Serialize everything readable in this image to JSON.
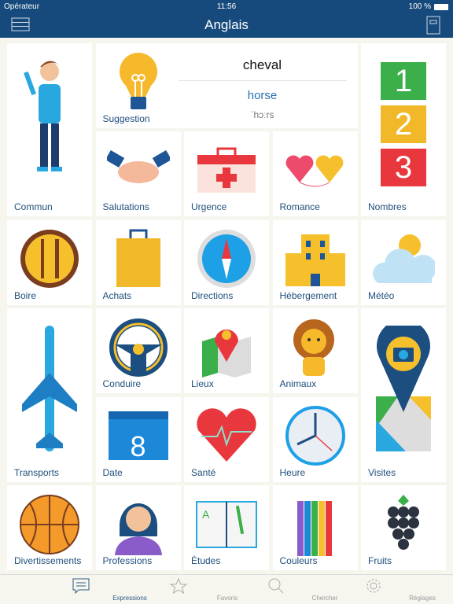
{
  "status": {
    "carrier": "Opérateur",
    "time": "11:56",
    "battery": "100 %"
  },
  "header": {
    "title": "Anglais"
  },
  "suggestion": {
    "label": "Suggestion",
    "word": "cheval",
    "translation": "horse",
    "phonetic": "ˈhɔːrs"
  },
  "tiles": {
    "commun": "Commun",
    "nombres": "Nombres",
    "salutations": "Salutations",
    "urgence": "Urgence",
    "romance": "Romance",
    "boire": "Boire",
    "achats": "Achats",
    "directions": "Directions",
    "hebergement": "Hébergement",
    "meteo": "Météo",
    "transports": "Transports",
    "conduire": "Conduire",
    "lieux": "Lieux",
    "animaux": "Animaux",
    "visites": "Visites",
    "date": "Date",
    "sante": "Santé",
    "heure": "Heure",
    "divertissements": "Divertissements",
    "professions": "Professions",
    "etudes": "Études",
    "couleurs": "Couleurs",
    "fruits": "Fruits"
  },
  "numbers": [
    "1",
    "2",
    "3"
  ],
  "calendar_day": "8",
  "tabbar": [
    {
      "label": "Expressions",
      "active": true
    },
    {
      "label": "Favoris"
    },
    {
      "label": "Chercher"
    },
    {
      "label": "Réglages"
    }
  ],
  "colors": {
    "header": "#174a7c",
    "label": "#1f4f7d",
    "accent": "#2a6fb0"
  }
}
